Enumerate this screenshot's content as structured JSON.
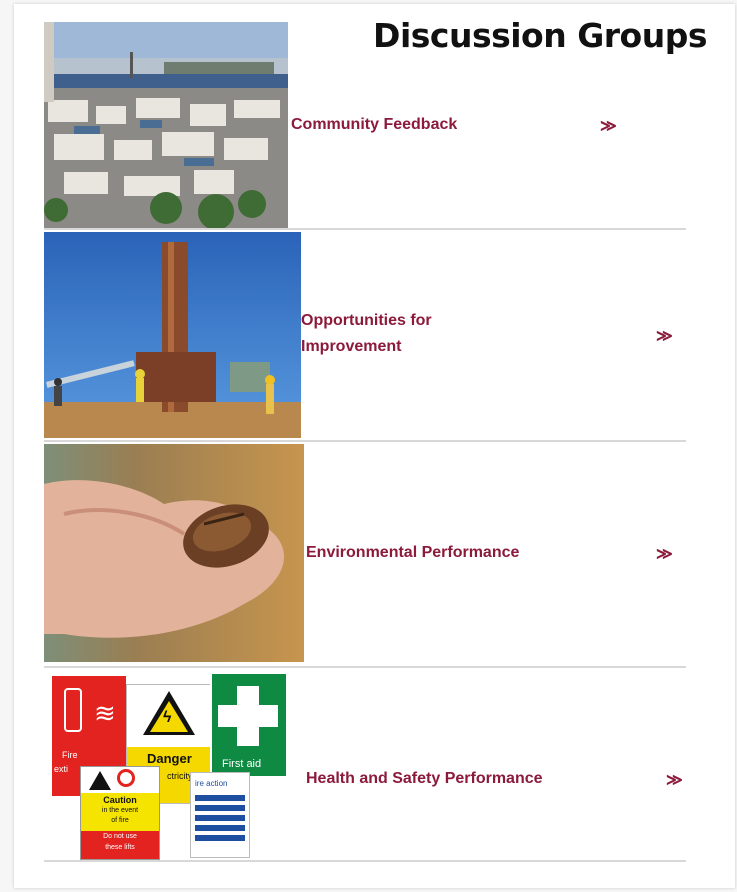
{
  "page": {
    "title": "Discussion Groups"
  },
  "groups": [
    {
      "label": "Community Feedback",
      "chevron": "≫",
      "image": "harbour-town-photo"
    },
    {
      "label": "Opportunities for Improvement",
      "chevron": "≫",
      "image": "drilling-rig-photo"
    },
    {
      "label": "Environmental Performance",
      "chevron": "≫",
      "image": "rock-in-hand-photo"
    },
    {
      "label": "Health and Safety Performance",
      "chevron": "≫",
      "image": "safety-signs-photo"
    }
  ],
  "signs": {
    "fire": "Fire",
    "fire_ext": "exti",
    "danger": "Danger",
    "danger_sub": "ctricity",
    "first_aid": "First aid",
    "caution": "Caution",
    "caution_sub1": "in the event",
    "caution_sub2": "of fire",
    "caution_red1": "Do not use",
    "caution_red2": "these lifts",
    "fire_action": "ire action"
  },
  "colors": {
    "link": "#8b1a3b",
    "divider": "#d8d8d8"
  }
}
